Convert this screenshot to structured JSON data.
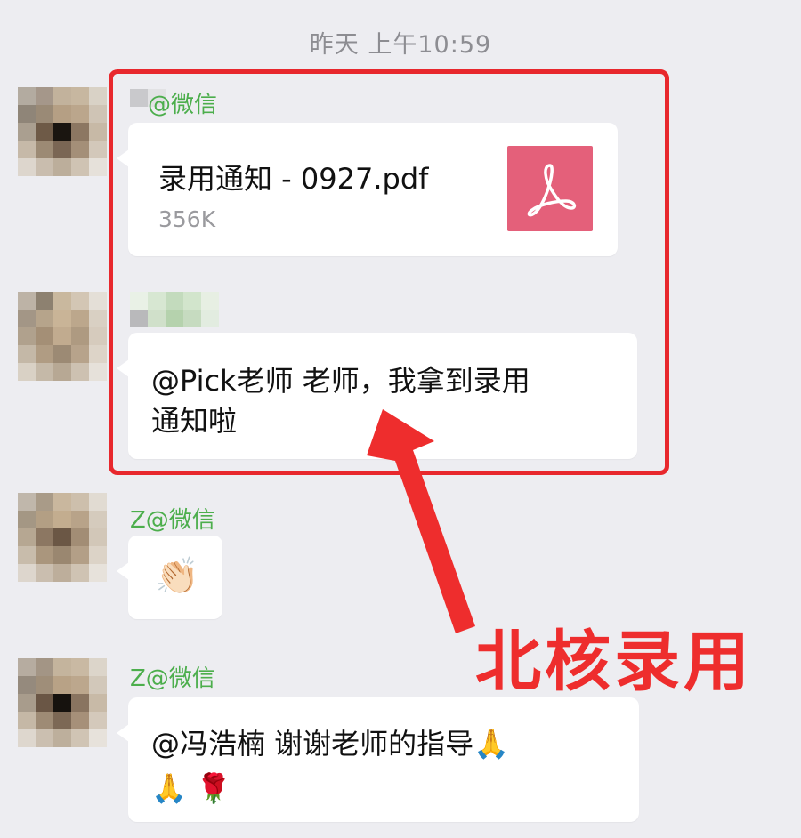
{
  "chat": {
    "timestamp": "昨天 上午10:59",
    "messages": [
      {
        "sender": "@微信",
        "type": "file",
        "file_name": "录用通知 - 0927.pdf",
        "file_size": "356K",
        "file_icon": "pdf-icon"
      },
      {
        "sender": "",
        "type": "text",
        "text": "@Pick老师 老师，我拿到录用\n通知啦"
      },
      {
        "sender": "Z@微信",
        "type": "emoji",
        "emoji": "👏🏻"
      },
      {
        "sender": "Z@微信",
        "type": "text",
        "text_line1": "@冯浩楠 谢谢老师的指导",
        "emoji_line1": "🙏",
        "emoji_line2": "🙏 🌹"
      }
    ]
  },
  "annotation": {
    "label": "北核录用",
    "color": "#ee2d2d",
    "highlight_color": "#e8282d"
  },
  "colors": {
    "background": "#ededf1",
    "bubble": "#ffffff",
    "sender_name": "#4cae4c",
    "pdf_icon_bg": "#e4607a"
  }
}
